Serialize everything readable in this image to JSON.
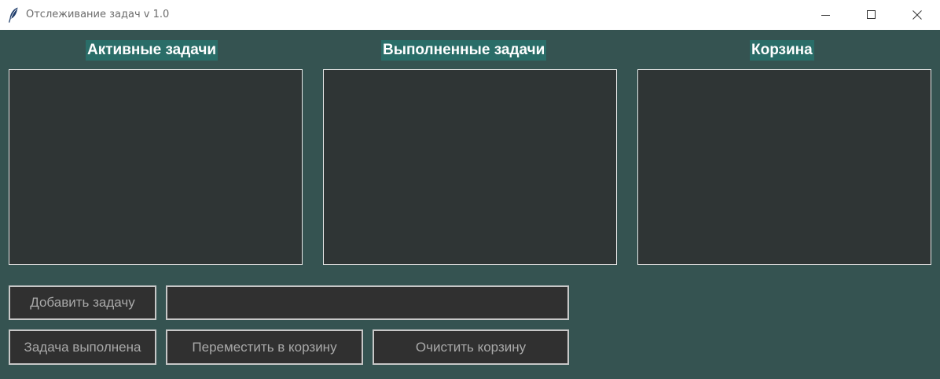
{
  "window": {
    "title": "Отслеживание задач v 1.0",
    "icon": "feather-icon",
    "controls": [
      "minimize-icon",
      "maximize-icon",
      "close-icon"
    ]
  },
  "columns": {
    "active": {
      "title": "Активные задачи",
      "items": []
    },
    "done": {
      "title": "Выполненные задачи",
      "items": []
    },
    "trash": {
      "title": "Корзина",
      "items": []
    }
  },
  "controls": {
    "add_label": "Добавить задачу",
    "task_input_value": "",
    "complete_label": "Задача выполнена",
    "move_label": "Переместить в корзину",
    "clear_label": "Очистить корзину"
  },
  "colors": {
    "background": "#355351",
    "heading_bg": "#2a6d68",
    "listbox_bg": "#2f3535",
    "button_bg": "#303030",
    "button_text": "#a9a9a9"
  }
}
